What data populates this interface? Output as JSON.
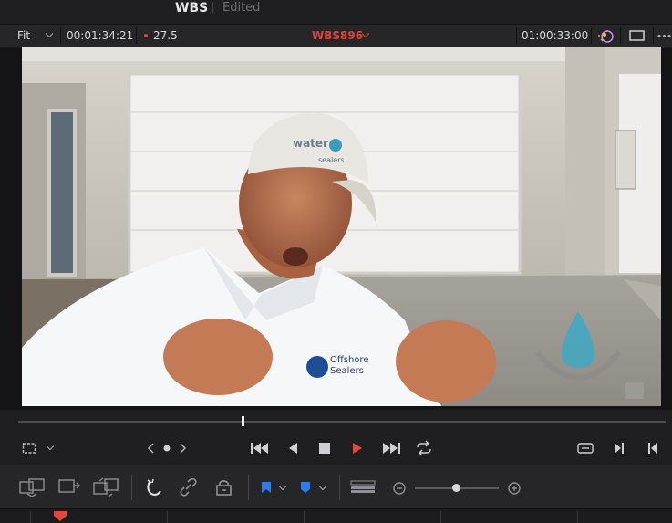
{
  "title_bar": {
    "project_name": "WBS",
    "status": "Edited"
  },
  "viewer_header": {
    "zoom_label": "Fit",
    "source_timecode": "00:01:34:21",
    "frame_rate": "27.5",
    "clip_name": "WBS896",
    "record_timecode": "01:00:33:00",
    "accent_color": "#e0453a"
  },
  "video_frame": {
    "cap_logo_text_1": "water",
    "cap_logo_text_2": "sealers",
    "shirt_logo_text_1": "Offshore",
    "shirt_logo_text_2": "Sealers"
  },
  "scrubber": {
    "playhead_progress": 0.35
  },
  "transport": {
    "buttons": [
      "frame-options-icon",
      "jog-icon",
      "skip-to-start-icon",
      "play-reverse-icon",
      "stop-icon",
      "play-icon",
      "skip-to-end-icon",
      "loop-icon",
      "match-frame-icon",
      "next-clip-icon",
      "previous-clip-icon"
    ]
  },
  "edit_toolbar": {
    "zoom_slider_level": 0.5,
    "flag_color": "#2f7be8",
    "marker_color": "#2f7be8"
  }
}
